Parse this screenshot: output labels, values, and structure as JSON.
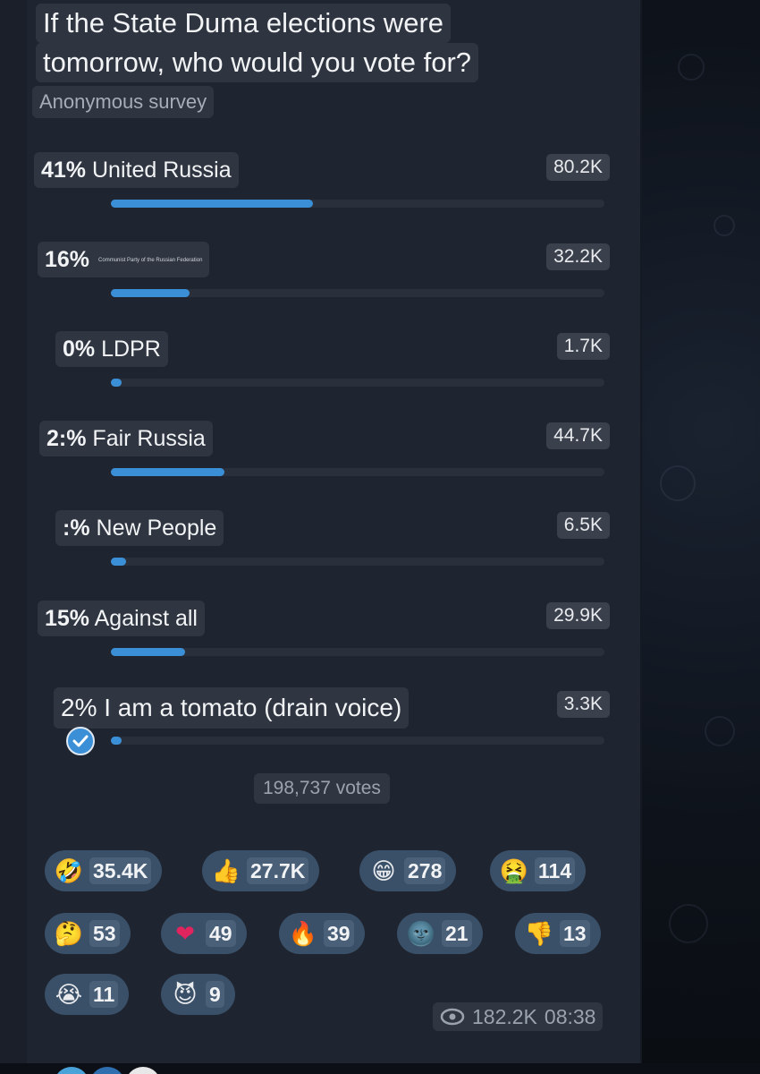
{
  "poll": {
    "question_line1": "If the State Duma elections were",
    "question_line2": "tomorrow, who would you vote for?",
    "type_label": "Anonymous survey",
    "options": [
      {
        "percent": "41%",
        "label": "United Russia",
        "count": "80.2K",
        "share": 0.41
      },
      {
        "percent": "16%",
        "label": "Communist Party of the Russian Federation",
        "count": "32.2K",
        "share": 0.16
      },
      {
        "percent": "0%",
        "label": "LDPR",
        "count": "1.7K",
        "share": 0.01
      },
      {
        "percent": "2:%",
        "label": "Fair Russia",
        "count": "44.7K",
        "share": 0.23
      },
      {
        "percent": ":%",
        "label": "New People",
        "count": "6.5K",
        "share": 0.03
      },
      {
        "percent": "15%",
        "label": "Against all",
        "count": "29.9K",
        "share": 0.15
      },
      {
        "percent": "2%",
        "label": "I am a tomato (drain voice)",
        "count": "3.3K",
        "share": 0.02,
        "selected": true
      }
    ],
    "total_votes": "198,737 votes"
  },
  "reactions": [
    {
      "icon": "rofl-emoji-icon",
      "glyph": "🤣",
      "count": "35.4K"
    },
    {
      "icon": "thumbs-up-emoji-icon",
      "glyph": "👍",
      "count": "27.7K"
    },
    {
      "icon": "grinning-emoji-icon",
      "glyph": "😁",
      "count": "278"
    },
    {
      "icon": "vomiting-emoji-icon",
      "glyph": "🤮",
      "count": "114"
    },
    {
      "icon": "thinking-emoji-icon",
      "glyph": "🤔",
      "count": "53"
    },
    {
      "icon": "heart-emoji-icon",
      "glyph": "❤",
      "count": "49"
    },
    {
      "icon": "fire-emoji-icon",
      "glyph": "🔥",
      "count": "39"
    },
    {
      "icon": "new-moon-face-emoji-icon",
      "glyph": "🌚",
      "count": "21"
    },
    {
      "icon": "thumbs-down-emoji-icon",
      "glyph": "👎",
      "count": "13"
    },
    {
      "icon": "crying-emoji-icon",
      "glyph": "😭",
      "count": "11"
    },
    {
      "icon": "smiling-imp-emoji-icon",
      "glyph": "😈",
      "count": "9"
    }
  ],
  "message_meta": {
    "views": "182.2K",
    "time": "08:38"
  },
  "colors": {
    "accent": "#3b8fd6",
    "bubble": "#1e2430",
    "reaction_pill": "#3a5068"
  }
}
